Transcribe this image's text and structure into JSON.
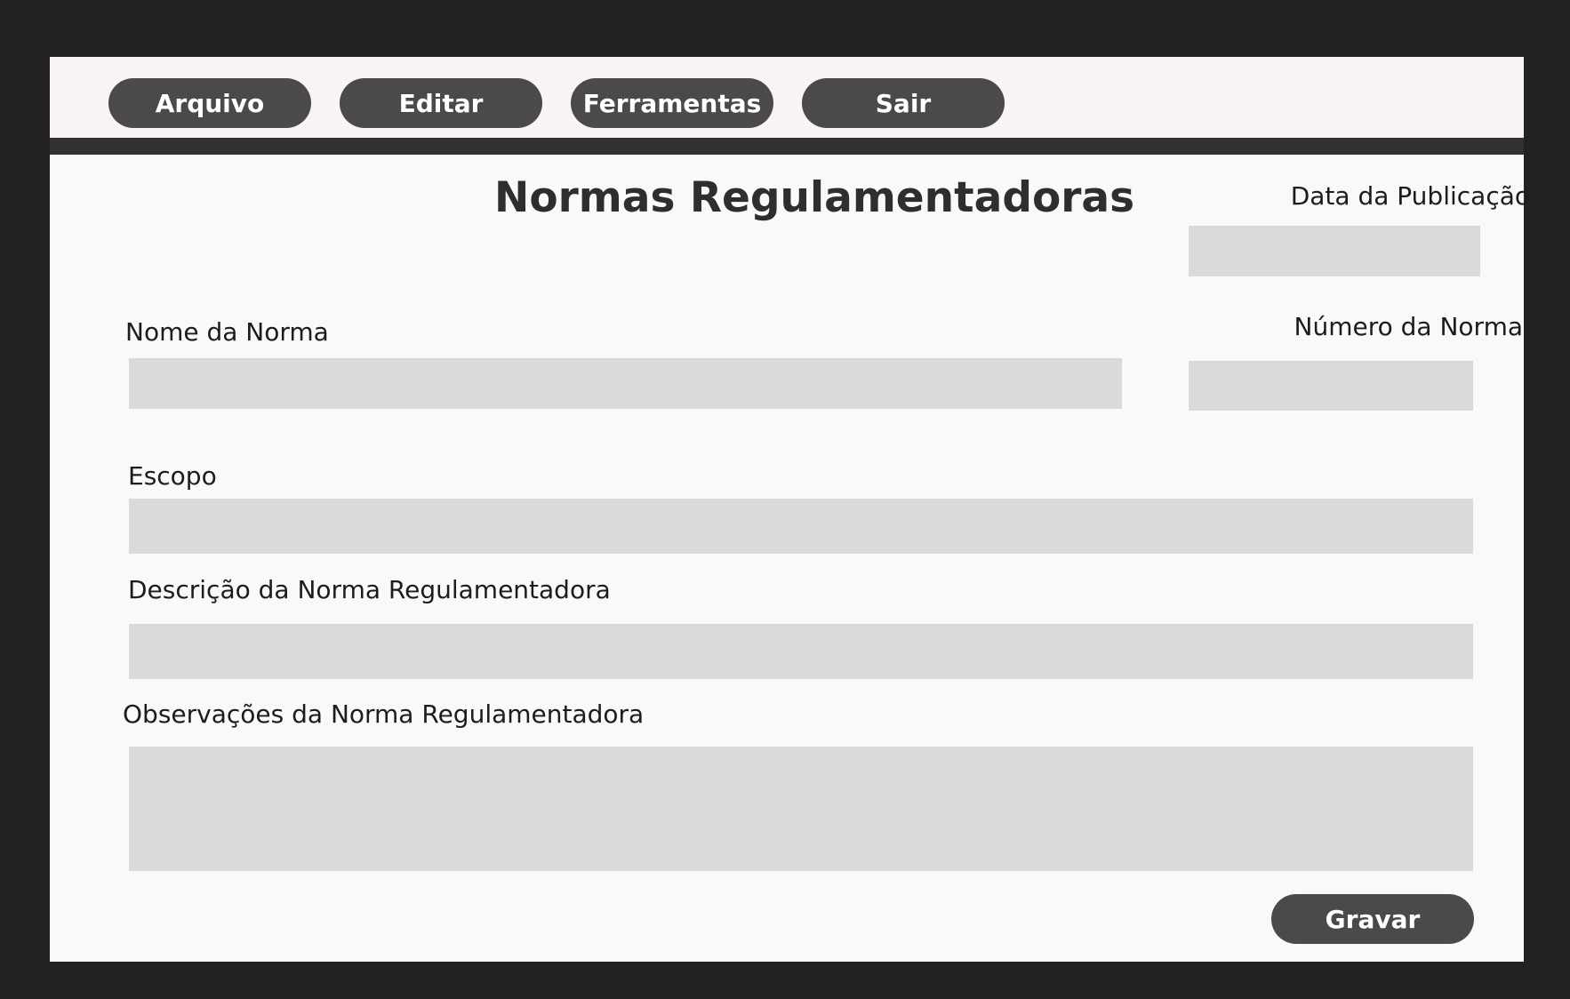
{
  "menu": {
    "items": [
      {
        "label": "Arquivo"
      },
      {
        "label": "Editar"
      },
      {
        "label": "Ferramentas"
      },
      {
        "label": "Sair"
      }
    ]
  },
  "form": {
    "title": "Normas Regulamentadoras",
    "fields": {
      "publication_date": {
        "label": "Data da Publicação",
        "value": ""
      },
      "norm_name": {
        "label": "Nome da Norma",
        "value": ""
      },
      "norm_number": {
        "label": "Número da Norma",
        "value": ""
      },
      "scope": {
        "label": "Escopo",
        "value": ""
      },
      "description": {
        "label": "Descrição da Norma Regulamentadora",
        "value": ""
      },
      "observations": {
        "label": "Observações da Norma Regulamentadora",
        "value": ""
      }
    },
    "save_label": "Gravar"
  },
  "colors": {
    "background": "#232221",
    "menubar": "#f7f4f3",
    "menubar_border": "#333231",
    "button": "#4b4a49",
    "field": "#dadada",
    "panel": "#f9f9f9"
  }
}
